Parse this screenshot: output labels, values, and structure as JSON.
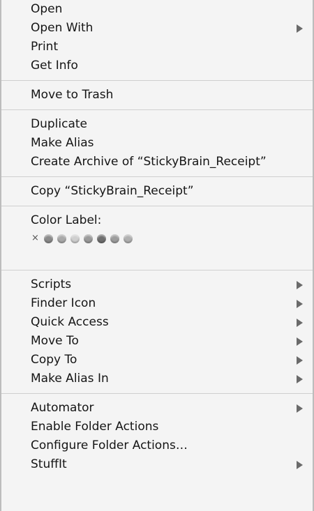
{
  "menu": {
    "groups": [
      {
        "items": [
          {
            "label": "Open",
            "submenu": false
          },
          {
            "label": "Open With",
            "submenu": true
          },
          {
            "label": "Print",
            "submenu": false
          },
          {
            "label": "Get Info",
            "submenu": false
          }
        ]
      },
      {
        "items": [
          {
            "label": "Move to Trash",
            "submenu": false
          }
        ]
      },
      {
        "items": [
          {
            "label": "Duplicate",
            "submenu": false
          },
          {
            "label": "Make Alias",
            "submenu": false
          },
          {
            "label": "Create Archive of “StickyBrain_Receipt”",
            "submenu": false
          }
        ]
      },
      {
        "items": [
          {
            "label": "Copy “StickyBrain_Receipt”",
            "submenu": false
          }
        ]
      },
      {
        "items": [
          {
            "label": "Scripts",
            "submenu": true
          },
          {
            "label": "Finder Icon",
            "submenu": true
          },
          {
            "label": "Quick Access",
            "submenu": true
          },
          {
            "label": "Move To",
            "submenu": true
          },
          {
            "label": "Copy To",
            "submenu": true
          },
          {
            "label": "Make Alias In",
            "submenu": true
          }
        ]
      },
      {
        "items": [
          {
            "label": "Automator",
            "submenu": true
          },
          {
            "label": "Enable Folder Actions",
            "submenu": false
          },
          {
            "label": "Configure Folder Actions…",
            "submenu": false
          },
          {
            "label": "StuffIt",
            "submenu": true
          }
        ]
      }
    ],
    "color_label": {
      "title": "Color Label:",
      "none_symbol": "×",
      "swatches": [
        "#8a8a8a",
        "#a9a9a9",
        "#cfcfcf",
        "#9a9a9a",
        "#6f6f6f",
        "#9d9d9d",
        "#b0b0b0"
      ]
    }
  }
}
